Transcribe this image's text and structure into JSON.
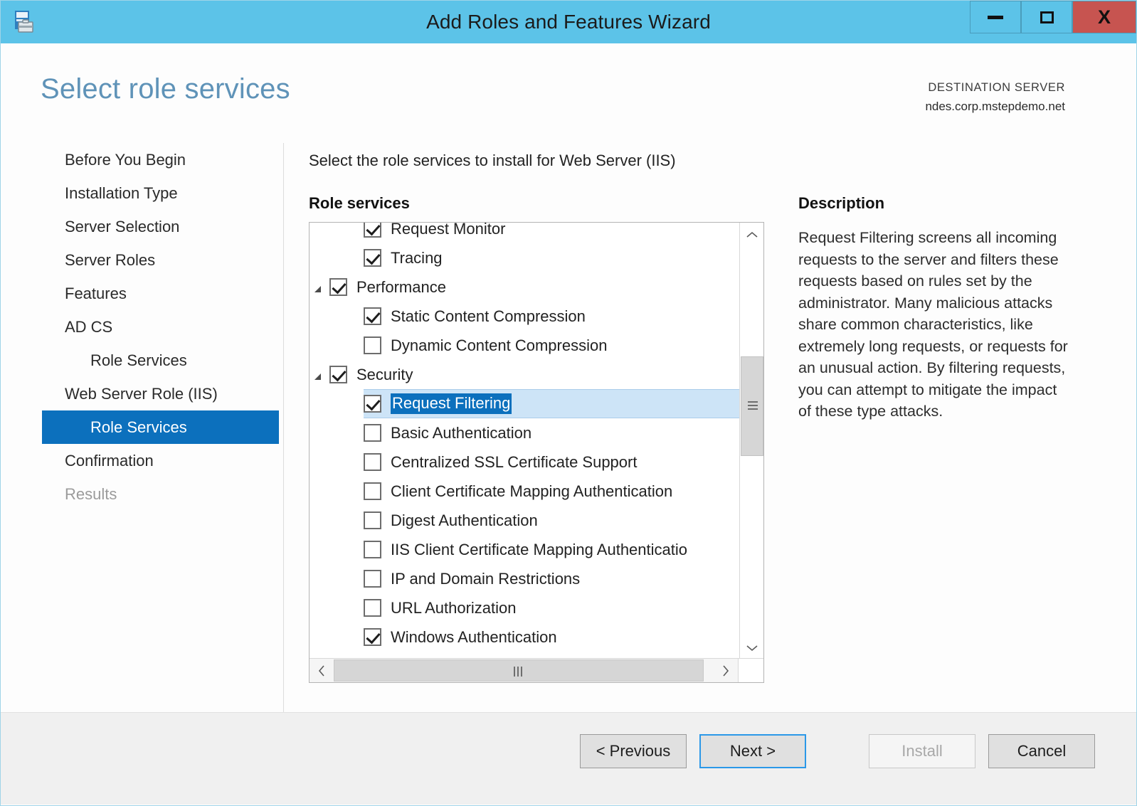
{
  "window": {
    "title": "Add Roles and Features Wizard",
    "icon": "wizard-roles-icon",
    "controls": {
      "minimize": "minimize-icon",
      "maximize": "maximize-icon",
      "close": "X"
    }
  },
  "header": {
    "page_title": "Select role services",
    "destination_label": "DESTINATION SERVER",
    "destination_server": "ndes.corp.mstepdemo.net"
  },
  "sidebar": {
    "items": [
      {
        "label": "Before You Begin",
        "level": 0,
        "state": "normal"
      },
      {
        "label": "Installation Type",
        "level": 0,
        "state": "normal"
      },
      {
        "label": "Server Selection",
        "level": 0,
        "state": "normal"
      },
      {
        "label": "Server Roles",
        "level": 0,
        "state": "normal"
      },
      {
        "label": "Features",
        "level": 0,
        "state": "normal"
      },
      {
        "label": "AD CS",
        "level": 0,
        "state": "normal"
      },
      {
        "label": "Role Services",
        "level": 1,
        "state": "normal"
      },
      {
        "label": "Web Server Role (IIS)",
        "level": 0,
        "state": "normal"
      },
      {
        "label": "Role Services",
        "level": 1,
        "state": "selected"
      },
      {
        "label": "Confirmation",
        "level": 0,
        "state": "normal"
      },
      {
        "label": "Results",
        "level": 0,
        "state": "disabled"
      }
    ]
  },
  "content": {
    "instruction": "Select the role services to install for Web Server (IIS)",
    "role_services_label": "Role services",
    "role_services": [
      {
        "label": "Request Monitor",
        "checked": true,
        "indent": 2,
        "expander": false,
        "selected": false,
        "clipped_top": true
      },
      {
        "label": "Tracing",
        "checked": true,
        "indent": 2,
        "expander": false,
        "selected": false
      },
      {
        "label": "Performance",
        "checked": true,
        "indent": 1,
        "expander": true,
        "selected": false
      },
      {
        "label": "Static Content Compression",
        "checked": true,
        "indent": 2,
        "expander": false,
        "selected": false
      },
      {
        "label": "Dynamic Content Compression",
        "checked": false,
        "indent": 2,
        "expander": false,
        "selected": false
      },
      {
        "label": "Security",
        "checked": true,
        "indent": 1,
        "expander": true,
        "selected": false
      },
      {
        "label": "Request Filtering",
        "checked": true,
        "indent": 2,
        "expander": false,
        "selected": true
      },
      {
        "label": "Basic Authentication",
        "checked": false,
        "indent": 2,
        "expander": false,
        "selected": false
      },
      {
        "label": "Centralized SSL Certificate Support",
        "checked": false,
        "indent": 2,
        "expander": false,
        "selected": false
      },
      {
        "label": "Client Certificate Mapping Authentication",
        "checked": false,
        "indent": 2,
        "expander": false,
        "selected": false
      },
      {
        "label": "Digest Authentication",
        "checked": false,
        "indent": 2,
        "expander": false,
        "selected": false
      },
      {
        "label": "IIS Client Certificate Mapping Authenticatio",
        "checked": false,
        "indent": 2,
        "expander": false,
        "selected": false
      },
      {
        "label": "IP and Domain Restrictions",
        "checked": false,
        "indent": 2,
        "expander": false,
        "selected": false
      },
      {
        "label": "URL Authorization",
        "checked": false,
        "indent": 2,
        "expander": false,
        "selected": false
      },
      {
        "label": "Windows Authentication",
        "checked": true,
        "indent": 2,
        "expander": false,
        "selected": false,
        "clipped_bottom": true
      }
    ],
    "scrollbars": {
      "up_arrow": "˄",
      "down_arrow": "˅",
      "left_arrow": "‹",
      "right_arrow": "›"
    }
  },
  "description": {
    "heading": "Description",
    "body": "Request Filtering screens all incoming requests to the server and filters these requests based on rules set by the administrator. Many malicious attacks share common characteristics, like extremely long requests, or requests for an unusual action. By filtering requests, you can attempt to mitigate the impact of these type attacks."
  },
  "footer": {
    "previous": "< Previous",
    "next": "Next >",
    "install": "Install",
    "cancel": "Cancel"
  },
  "colors": {
    "titlebar": "#5cc3e8",
    "close_button": "#c75450",
    "accent_selection": "#0c70bd",
    "row_highlight": "#cde4f7",
    "page_title": "#5f93b8",
    "footer_bg": "#f0f0f0"
  }
}
